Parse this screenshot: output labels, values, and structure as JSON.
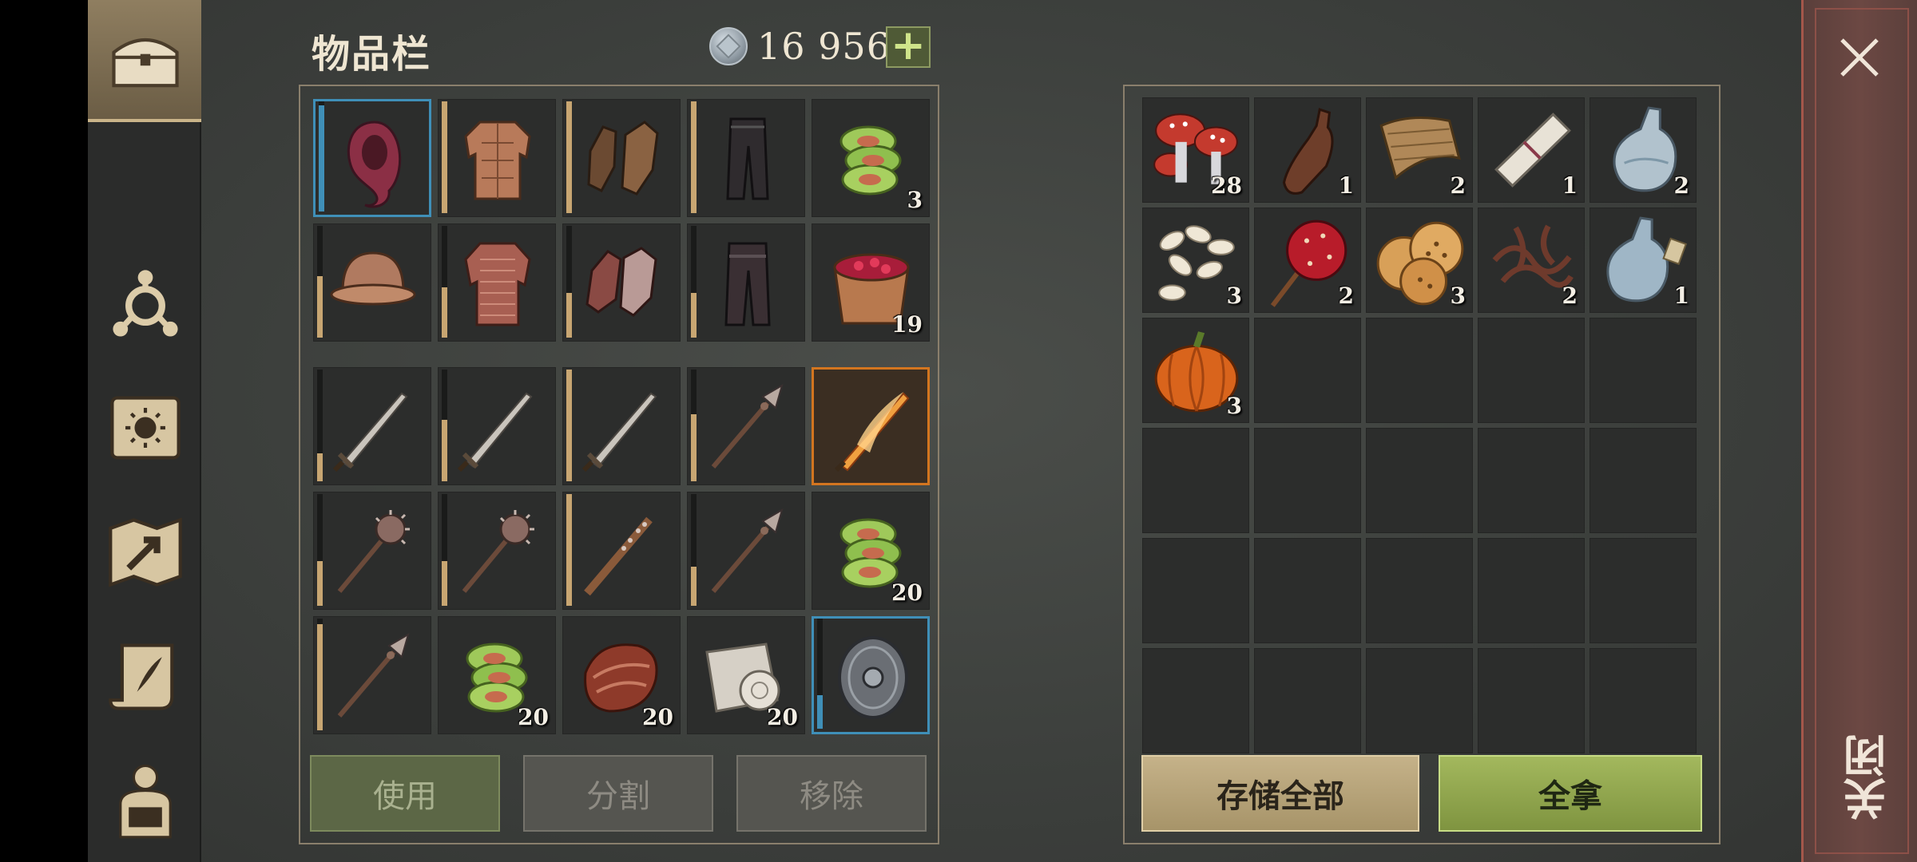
{
  "header": {
    "title": "物品栏",
    "currency_amount": "16 956",
    "plus_label": "+"
  },
  "sidebar": {
    "items": [
      {
        "name": "chest-icon"
      },
      {
        "name": "crafting-icon"
      },
      {
        "name": "journal-icon"
      },
      {
        "name": "map-icon"
      },
      {
        "name": "quest-scroll-icon"
      },
      {
        "name": "character-icon"
      }
    ]
  },
  "inventory": {
    "equipment": [
      {
        "item": "hood",
        "count": "",
        "durability": 95,
        "selected": "blue"
      },
      {
        "item": "padded-jacket",
        "count": "",
        "durability": 100
      },
      {
        "item": "leather-gloves",
        "count": "",
        "durability": 100
      },
      {
        "item": "leather-pants",
        "count": "",
        "durability": 100
      },
      {
        "item": "green-bandage",
        "count": "3"
      },
      {
        "item": "iron-helmet",
        "count": "",
        "durability": 55
      },
      {
        "item": "chainmail-shirt",
        "count": "",
        "durability": 45
      },
      {
        "item": "chainmail-gloves",
        "count": "",
        "durability": 40
      },
      {
        "item": "chainmail-pants",
        "count": "",
        "durability": 40
      },
      {
        "item": "berry-bowl",
        "count": "19"
      }
    ],
    "items": [
      {
        "item": "sword",
        "count": "",
        "durability": 25
      },
      {
        "item": "sword",
        "count": "",
        "durability": 55
      },
      {
        "item": "sword",
        "count": "",
        "durability": 100
      },
      {
        "item": "spear",
        "count": "",
        "durability": 60
      },
      {
        "item": "flaming-sword",
        "count": "",
        "selected": "orange"
      },
      {
        "item": "mace",
        "count": "",
        "durability": 40
      },
      {
        "item": "mace",
        "count": "",
        "durability": 40
      },
      {
        "item": "spiked-club",
        "count": "",
        "durability": 100
      },
      {
        "item": "spear",
        "count": "",
        "durability": 35
      },
      {
        "item": "green-bandage",
        "count": "20"
      },
      {
        "item": "spear",
        "count": "",
        "durability": 95
      },
      {
        "item": "green-bandage",
        "count": "20"
      },
      {
        "item": "raw-meat",
        "count": "20"
      },
      {
        "item": "cloth-roll",
        "count": "20"
      },
      {
        "item": "round-shield",
        "count": "",
        "durability": 30,
        "selected": "blue"
      }
    ]
  },
  "actions": {
    "use": "使用",
    "split": "分割",
    "remove": "移除"
  },
  "storage": {
    "items": [
      {
        "item": "mushrooms",
        "count": "28"
      },
      {
        "item": "bottle",
        "count": "1"
      },
      {
        "item": "cloth",
        "count": "2"
      },
      {
        "item": "paper-roll",
        "count": "1"
      },
      {
        "item": "water-flask",
        "count": "2"
      },
      {
        "item": "seeds",
        "count": "3"
      },
      {
        "item": "candy-apple",
        "count": "2"
      },
      {
        "item": "crackers",
        "count": "3"
      },
      {
        "item": "twine",
        "count": "2"
      },
      {
        "item": "water-flask-tagged",
        "count": "1"
      },
      {
        "item": "pumpkin",
        "count": "3"
      }
    ],
    "total_slots": 30,
    "store_all": "存储全部",
    "take_all": "全拿"
  },
  "close": {
    "label": "关闭"
  }
}
